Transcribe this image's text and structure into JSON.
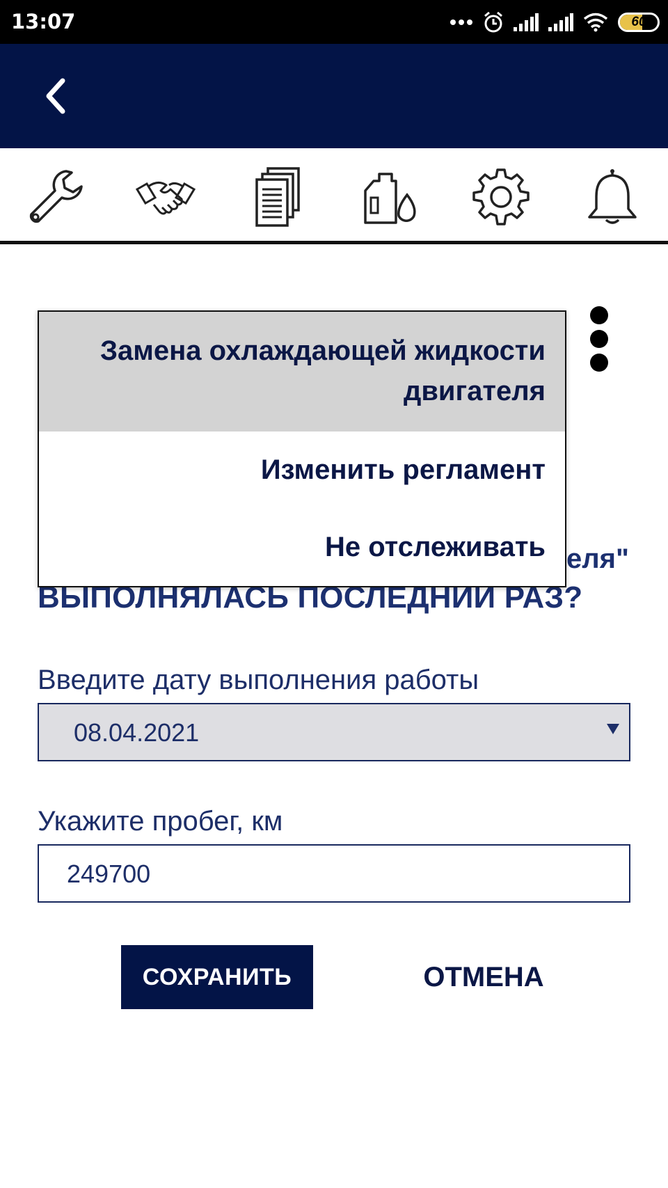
{
  "status_bar": {
    "time": "13:07",
    "battery": "60",
    "battery_level": 0.6
  },
  "app_bar": {
    "back_icon": "chevron-left-icon"
  },
  "toolbar": {
    "icons": [
      "wrench-icon",
      "handshake-icon",
      "documents-icon",
      "oil-canister-icon",
      "gear-icon",
      "bell-icon"
    ]
  },
  "question": {
    "line1_fragment": "еля\"",
    "line2": "ВЫПОЛНЯЛАСЬ ПОСЛЕДНИЙ РАЗ?"
  },
  "form": {
    "date_label": "Введите дату выполнения работы",
    "date_value": "08.04.2021",
    "mileage_label": "Укажите пробег, км",
    "mileage_value": "249700"
  },
  "buttons": {
    "save": "СОХРАНИТЬ",
    "cancel": "ОТМЕНА"
  },
  "menu": {
    "title_line1": "Замена охлаждающей жидкости",
    "title_line2": "двигателя",
    "items": [
      "Изменить регламент",
      "Не отслеживать"
    ]
  },
  "colors": {
    "primary": "#031447",
    "text": "#0b1746",
    "select_bg": "#dedee2",
    "menu_header_bg": "#d3d3d3"
  }
}
